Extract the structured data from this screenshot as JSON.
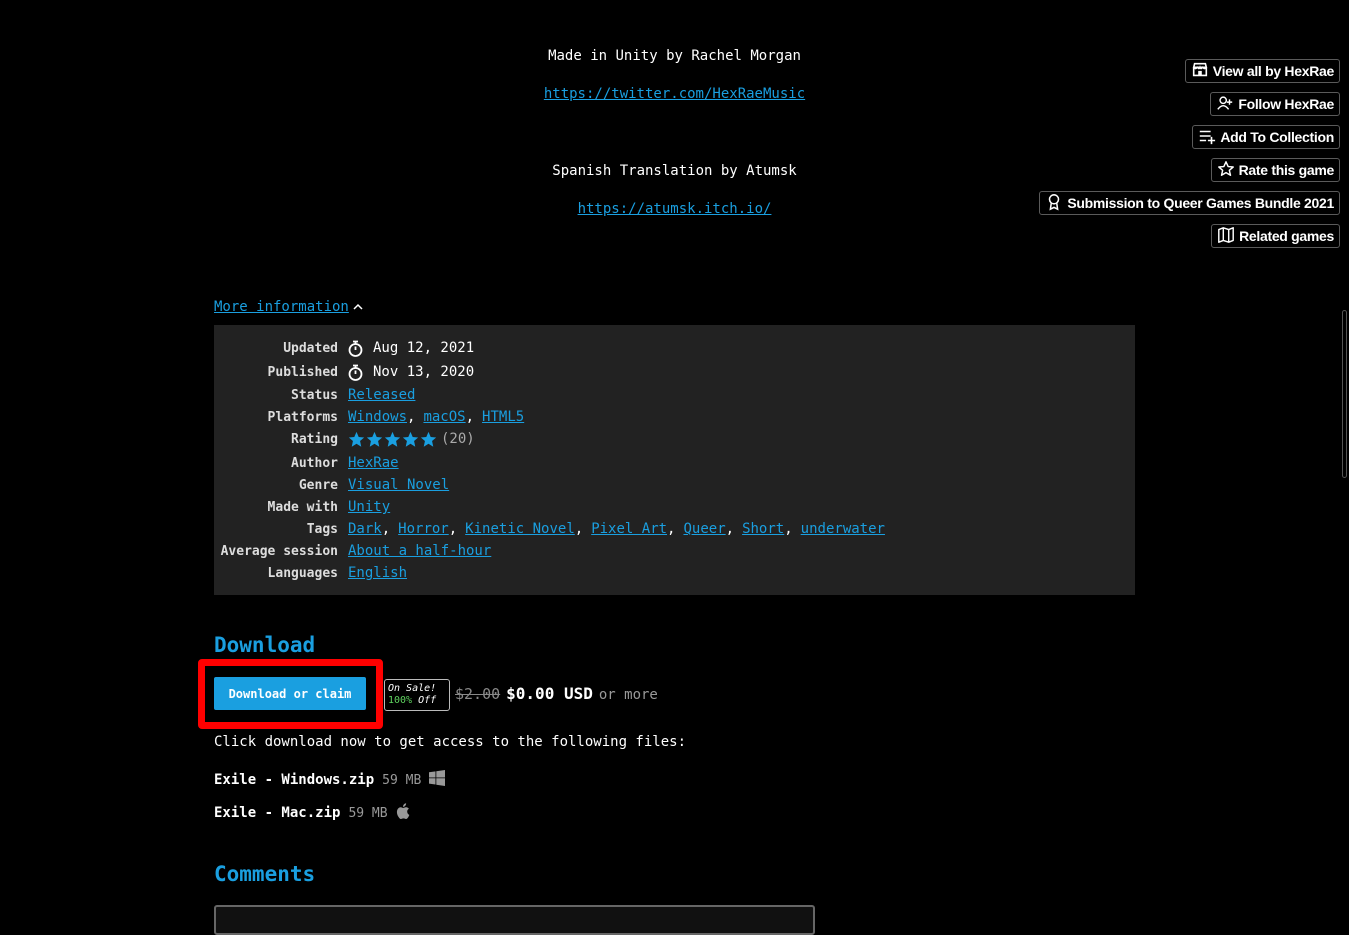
{
  "credits": {
    "made_in": "Made in Unity by Rachel Morgan",
    "twitter_url": "https://twitter.com/HexRaeMusic",
    "translation": "Spanish Translation by Atumsk",
    "atumsk_url": "https://atumsk.itch.io/"
  },
  "actions": [
    {
      "label": "View all by HexRae",
      "icon": "store-icon"
    },
    {
      "label": "Follow HexRae",
      "icon": "follow-user-icon"
    },
    {
      "label": "Add To Collection",
      "icon": "add-to-list-icon"
    },
    {
      "label": "Rate this game",
      "icon": "star-icon"
    },
    {
      "label": "Submission to Queer Games Bundle 2021",
      "icon": "ribbon-icon"
    },
    {
      "label": "Related games",
      "icon": "map-icon"
    }
  ],
  "more_info": {
    "label": "More information"
  },
  "info": {
    "updated": {
      "key": "Updated",
      "value": "Aug 12, 2021"
    },
    "published": {
      "key": "Published",
      "value": "Nov 13, 2020"
    },
    "status": {
      "key": "Status",
      "value": "Released"
    },
    "platforms": {
      "key": "Platforms",
      "values": [
        "Windows",
        "macOS",
        "HTML5"
      ]
    },
    "rating": {
      "key": "Rating",
      "stars": 5,
      "count": "(20)"
    },
    "author": {
      "key": "Author",
      "value": "HexRae"
    },
    "genre": {
      "key": "Genre",
      "value": "Visual Novel"
    },
    "made_with": {
      "key": "Made with",
      "value": "Unity"
    },
    "tags": {
      "key": "Tags",
      "values": [
        "Dark",
        "Horror",
        "Kinetic Novel",
        "Pixel Art",
        "Queer",
        "Short",
        "underwater"
      ]
    },
    "avg_session": {
      "key": "Average session",
      "value": "About a half-hour"
    },
    "languages": {
      "key": "Languages",
      "value": "English"
    }
  },
  "download": {
    "title": "Download",
    "button_label": "Download or claim",
    "sale_line1": "On Sale!",
    "sale_pct": "100%",
    "sale_off": "Off",
    "old_price": "$2.00",
    "new_price": "$0.00 USD",
    "or_more": "or more",
    "files_intro": "Click download now to get access to the following files:",
    "files": [
      {
        "name": "Exile - Windows.zip",
        "size": "59 MB",
        "platform_icon": "windows-icon"
      },
      {
        "name": "Exile - Mac.zip",
        "size": "59 MB",
        "platform_icon": "apple-icon"
      }
    ]
  },
  "comments": {
    "title": "Comments"
  },
  "colors": {
    "link": "#1a9fe0",
    "panel": "#222222",
    "highlight": "#ff0000",
    "sale_pct": "#5fd35f"
  }
}
